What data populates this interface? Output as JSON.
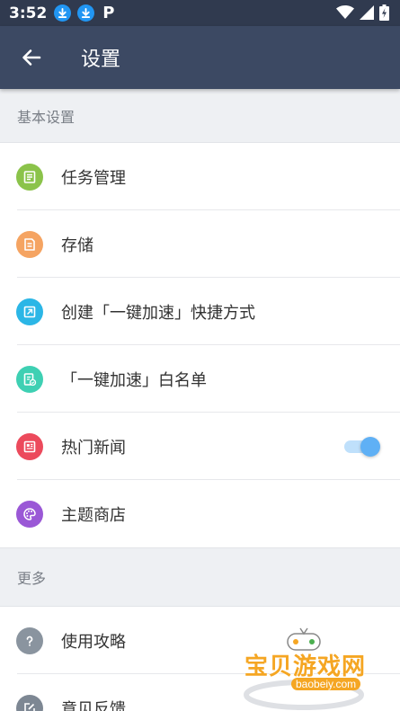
{
  "status_bar": {
    "time": "3:52",
    "extra_icon": "P"
  },
  "header": {
    "title": "设置"
  },
  "sections": [
    {
      "title": "基本设置",
      "items": [
        {
          "label": "任务管理",
          "icon": "task-icon",
          "color": "#8bc34a"
        },
        {
          "label": "存储",
          "icon": "storage-icon",
          "color": "#f5a462"
        },
        {
          "label": "创建「一键加速」快捷方式",
          "icon": "shortcut-icon",
          "color": "#2bb6e6"
        },
        {
          "label": "「一键加速」白名单",
          "icon": "whitelist-icon",
          "color": "#3ed0b3"
        },
        {
          "label": "热门新闻",
          "icon": "news-icon",
          "color": "#ec4a5c",
          "toggle_on": true
        },
        {
          "label": "主题商店",
          "icon": "palette-icon",
          "color": "#9a58d6"
        }
      ]
    },
    {
      "title": "更多",
      "items": [
        {
          "label": "使用攻略",
          "icon": "help-icon",
          "color": "#8a949f"
        },
        {
          "label": "意见反馈",
          "icon": "feedback-icon",
          "color": "#7d8793"
        }
      ]
    }
  ],
  "watermark": {
    "text": "宝贝游戏网",
    "url": "baobeiy.com"
  }
}
